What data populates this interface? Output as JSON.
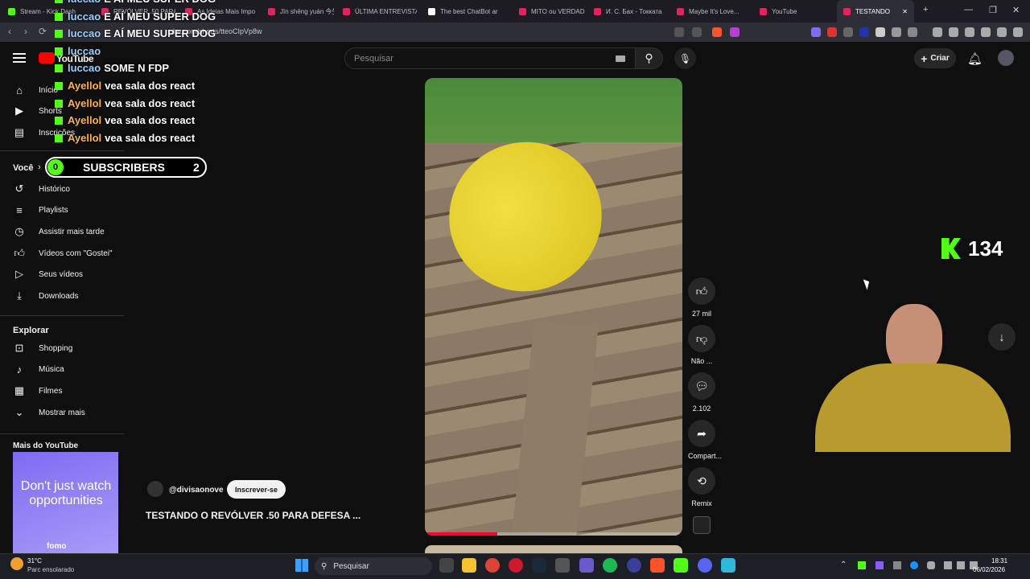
{
  "tabs": [
    {
      "label": "Stream - Kick Dash",
      "color": "#53fc18"
    },
    {
      "label": "REVÓLVER .50 PARA",
      "color": "#e0245e"
    },
    {
      "label": "As Ideias Mais Impo",
      "color": "#e0245e"
    },
    {
      "label": "Jīn shēng yuán 今生",
      "color": "#e0245e"
    },
    {
      "label": "ÚLTIMA ENTREVISTA",
      "color": "#e0245e"
    },
    {
      "label": "The best ChatBot ar",
      "color": "#ffffff"
    },
    {
      "label": "MITO ou VERDADE",
      "color": "#e0245e"
    },
    {
      "label": "И. С. Бах - Токката",
      "color": "#e0245e"
    },
    {
      "label": "Maybe It's Love...",
      "color": "#e0245e"
    },
    {
      "label": "YouTube",
      "color": "#e0245e"
    },
    {
      "label": "TESTANDO",
      "color": "#e0245e",
      "active": true
    }
  ],
  "browser": {
    "url": "ube.com/shorts/tteoCIpVp8w",
    "new_tab": "+",
    "minimize": "—",
    "restore": "❐",
    "close": "✕",
    "tab_close": "✕"
  },
  "youtube": {
    "logo_text": "YouTube",
    "search_placeholder": "Pesquisar",
    "create_label": "Criar"
  },
  "sidebar": {
    "top": [
      {
        "label": "Início",
        "icon": "home-icon"
      },
      {
        "label": "Shorts",
        "icon": "shorts-icon"
      },
      {
        "label": "Inscrições",
        "icon": "subscriptions-icon"
      }
    ],
    "you_header": "Você",
    "you_items": [
      {
        "label": "Histórico",
        "icon": "history-icon"
      },
      {
        "label": "Playlists",
        "icon": "playlists-icon"
      },
      {
        "label": "Assistir mais tarde",
        "icon": "clock-icon"
      },
      {
        "label": "Vídeos com \"Gostei\"",
        "icon": "thumbs-up-icon"
      },
      {
        "label": "Seus vídeos",
        "icon": "video-icon"
      },
      {
        "label": "Downloads",
        "icon": "download-icon"
      }
    ],
    "explore_header": "Explorar",
    "explore_items": [
      {
        "label": "Shopping",
        "icon": "shopping-bag-icon"
      },
      {
        "label": "Música",
        "icon": "music-note-icon"
      },
      {
        "label": "Filmes",
        "icon": "film-icon"
      },
      {
        "label": "Mostrar mais",
        "icon": "chevron-down-icon"
      }
    ],
    "more_header": "Mais do YouTube",
    "ad_text": "Don't just watch opportunities",
    "ad_brand": "fomo"
  },
  "short": {
    "channel": "@divisaonove",
    "subscribe_label": "Inscrever-se",
    "title": "TESTANDO O REVÓLVER .50 PARA DEFESA ...",
    "likes": "27 mil",
    "dislike_label": "Não ...",
    "comments": "2.102",
    "share_label": "Compart...",
    "remix_label": "Remix",
    "progress": 0.28
  },
  "overlay": {
    "chat": [
      {
        "user": "luccao",
        "msg": "E AÍ MEU SUPER DOG",
        "style": "u"
      },
      {
        "user": "luccao",
        "msg": "E AÍ MEU SUPER DOG",
        "style": "u"
      },
      {
        "user": "luccao",
        "msg": "E AÍ MEU SUPER DOG",
        "style": "u"
      },
      {
        "user": "luccao",
        "msg": "",
        "style": "u"
      },
      {
        "user": "luccao",
        "msg": "SOME N FDP",
        "style": "u"
      },
      {
        "user": "Ayellol",
        "msg": "vea sala dos react",
        "style": "u2"
      },
      {
        "user": "Ayellol",
        "msg": "vea sala dos react",
        "style": "u2"
      },
      {
        "user": "Ayellol",
        "msg": "vea sala dos react",
        "style": "u2"
      },
      {
        "user": "Ayellol",
        "msg": "vea sala dos react",
        "style": "u2"
      }
    ],
    "sub_left": "0",
    "sub_label": "SUBSCRIBERS",
    "sub_right": "2",
    "kick_viewers": "134"
  },
  "taskbar": {
    "weather_temp": "31°C",
    "weather_desc": "Parc ensolarado",
    "search": "Pesquisar",
    "time": "18:31",
    "date": "06/02/2026"
  }
}
